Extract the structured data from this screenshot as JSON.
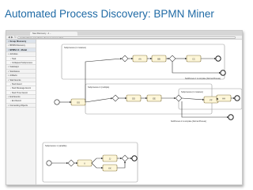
{
  "slide": {
    "title": "Automated Process Discovery: BPMN Miner"
  },
  "browser": {
    "tab_title": "New Discovery - 2 ...",
    "url": "localhost/bpmn-miner/bpmn-discovery-process.html"
  },
  "sidebar": {
    "rows": [
      {
        "label": "Group Discovery",
        "kind": "head"
      },
      {
        "label": "BPMN Discovery",
        "kind": "plain"
      },
      {
        "label": "BPMN 2.0 - Model",
        "kind": "head"
      },
      {
        "label": "Activities",
        "kind": "plain"
      },
      {
        "label": "Task",
        "kind": "sub"
      },
      {
        "label": "Collapsed Subprocess",
        "kind": "sub"
      },
      {
        "label": "Gateways",
        "kind": "plain"
      },
      {
        "label": "Swimlanes",
        "kind": "plain"
      },
      {
        "label": "Artifacts",
        "kind": "plain"
      },
      {
        "label": "Start Events",
        "kind": "plain"
      },
      {
        "label": "Start Event",
        "kind": "sub"
      },
      {
        "label": "Start Message Event",
        "kind": "sub"
      },
      {
        "label": "Start Timer Event",
        "kind": "sub"
      },
      {
        "label": "End Events",
        "kind": "plain"
      },
      {
        "label": "End Event",
        "kind": "sub"
      },
      {
        "label": "Connecting Objects",
        "kind": "plain"
      }
    ]
  },
  "diagram": {
    "pools": [
      {
        "label": "Subprocess (1 instance)"
      },
      {
        "label": "Subprocess 2 (multiple)"
      },
      {
        "label": "Subprocess (1 instance)"
      },
      {
        "label": "Subprocess 1 (variable)"
      }
    ],
    "tasks": [
      {
        "label": "AA"
      },
      {
        "label": "BB"
      },
      {
        "label": "CC"
      },
      {
        "label": "DD"
      },
      {
        "label": "EE"
      },
      {
        "label": "FF"
      },
      {
        "label": "GG"
      },
      {
        "label": "HH"
      },
      {
        "label": "II"
      },
      {
        "label": "JJ"
      },
      {
        "label": "KK"
      }
    ],
    "flow_labels": [
      {
        "label": "SubProcess 1 is complete [Normal Process]"
      },
      {
        "label": "SubProcess 2 is complete [Normal Process]"
      }
    ]
  },
  "colors": {
    "title": "#1f6aa5",
    "task_fill": "#fdf6d8",
    "task_stroke": "#8a7a45",
    "pool_stroke": "#9a9a9a",
    "flow": "#333333"
  }
}
